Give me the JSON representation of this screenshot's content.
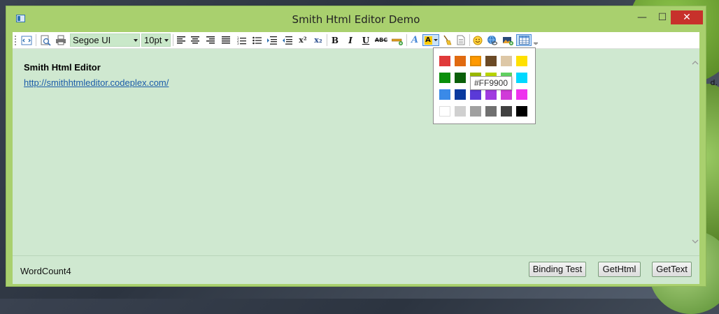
{
  "window": {
    "title": "Smith Html Editor Demo",
    "minimize_glyph": "—",
    "maximize_glyph": "☐",
    "close_glyph": "✕"
  },
  "desktop": {
    "partial_text": "d."
  },
  "toolbar": {
    "font_family": "Segoe UI",
    "font_size": "10pt",
    "buttons": [
      "view-source-icon",
      "print-preview-icon",
      "print-icon",
      "align-left-icon",
      "align-center-icon",
      "align-right-icon",
      "justify-icon",
      "numbered-list-icon",
      "bullet-list-icon",
      "indent-icon",
      "outdent-icon",
      "superscript-icon",
      "subscript-icon",
      "bold-icon",
      "italic-icon",
      "underline-icon",
      "strikethrough-icon",
      "horizontal-rule-icon",
      "font-color-icon",
      "highlight-color-icon",
      "clear-format-icon",
      "paste-text-icon",
      "emoticon-icon",
      "hyperlink-icon",
      "insert-image-icon",
      "insert-table-icon"
    ],
    "superscript_label": "x²",
    "subscript_label": "x₂",
    "bold_label": "B",
    "italic_label": "I",
    "underline_label": "U",
    "strike_label": "ABC",
    "font_color_label": "A",
    "highlight_label": "A"
  },
  "editor": {
    "heading": "Smith Html Editor",
    "link": "http://smithhtmleditor.codeplex.com/"
  },
  "color_picker": {
    "selected": "#FF9900",
    "tooltip": "#FF9900",
    "rows": [
      [
        "#e03a3a",
        "#e06a10",
        "#ff9900",
        "#6b4a26",
        "#ddc7a6",
        "#ffe000"
      ],
      [
        "#0a8f0a",
        "#0a5f0a",
        "#99b800",
        "#b8d400",
        "#60d060",
        "#00d8ff"
      ],
      [
        "#3a8ae8",
        "#0a3a9f",
        "#5a3ad8",
        "#a03ae0",
        "#d03ad8",
        "#ee33ee"
      ],
      [
        "#ffffff",
        "#d0d0d0",
        "#a0a0a0",
        "#707070",
        "#404040",
        "#000000"
      ]
    ]
  },
  "footer": {
    "word_count": "WordCount4",
    "binding_test": "Binding Test",
    "get_html": "GetHtml",
    "get_text": "GetText"
  }
}
